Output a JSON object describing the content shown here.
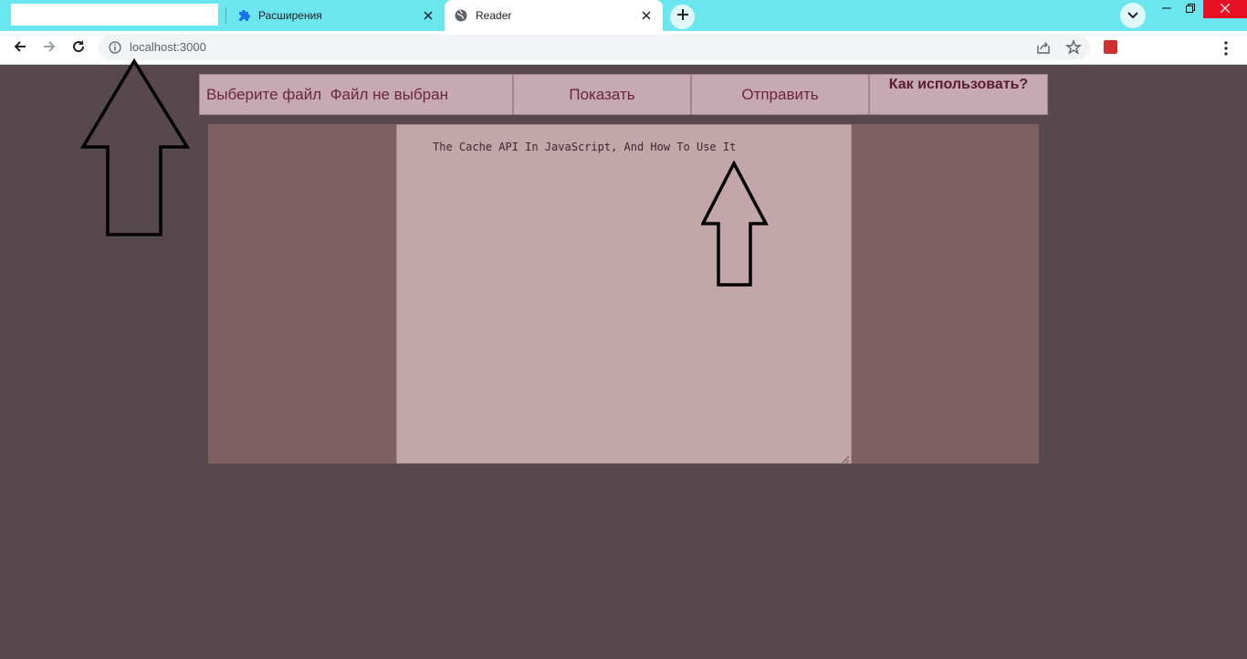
{
  "browser": {
    "tabs": [
      {
        "title": "Расширения",
        "icon": "puzzle-icon",
        "icon_color": "#1a73e8"
      },
      {
        "title": "Reader",
        "icon": "globe-icon",
        "active": true
      }
    ],
    "address": "localhost:3000",
    "tabstrip_color": "#6ce6ee"
  },
  "app": {
    "file_button_label": "Выберите файл",
    "file_status": "Файл не выбран",
    "show_label": "Показать",
    "send_label": "Отправить",
    "howto_label": "Как использовать?",
    "editor_text": "The Cache API In JavaScript, And How To Use It"
  },
  "colors": {
    "page_bg": "#56484d",
    "button_bg": "#c7a9b3",
    "panel_bg": "#7e5f62",
    "editor_bg": "#c2a6a9"
  }
}
